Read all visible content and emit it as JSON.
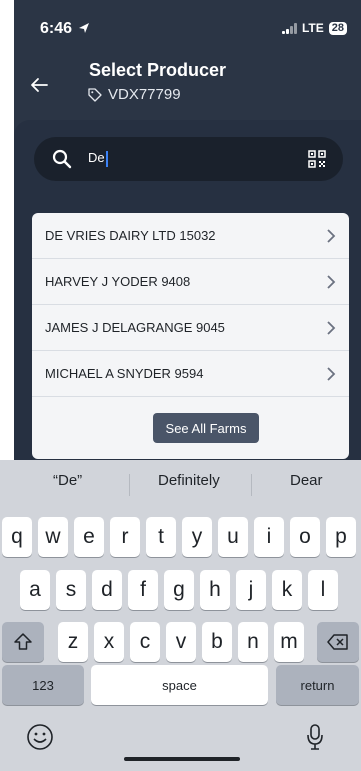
{
  "status_bar": {
    "time": "6:46",
    "network": "LTE",
    "battery": "28"
  },
  "header": {
    "back_icon": "arrow-left-icon",
    "title": "Select Producer",
    "subtitle": "VDX77799",
    "subtitle_icon": "tag-icon"
  },
  "search": {
    "value": "De",
    "search_icon": "search-icon",
    "qr_icon": "qr-code-icon"
  },
  "producers": [
    {
      "label": "DE VRIES DAIRY LTD 15032"
    },
    {
      "label": "HARVEY J YODER 9408"
    },
    {
      "label": "JAMES J DELAGRANGE 9045"
    },
    {
      "label": "MICHAEL A SNYDER 9594"
    }
  ],
  "see_all_label": "See All Farms",
  "keyboard": {
    "suggestions": [
      "“De”",
      "Definitely",
      "Dear"
    ],
    "row1": [
      "q",
      "w",
      "e",
      "r",
      "t",
      "y",
      "u",
      "i",
      "o",
      "p"
    ],
    "row2": [
      "a",
      "s",
      "d",
      "f",
      "g",
      "h",
      "j",
      "k",
      "l"
    ],
    "row3": [
      "z",
      "x",
      "c",
      "v",
      "b",
      "n",
      "m"
    ],
    "numbers_label": "123",
    "space_label": "space",
    "return_label": "return"
  },
  "colors": {
    "app_bg": "#2b3545",
    "search_bg": "#1a212c",
    "caret": "#3b82f6",
    "button_bg": "#4a5568",
    "keyboard_bg": "#d1d4da"
  }
}
